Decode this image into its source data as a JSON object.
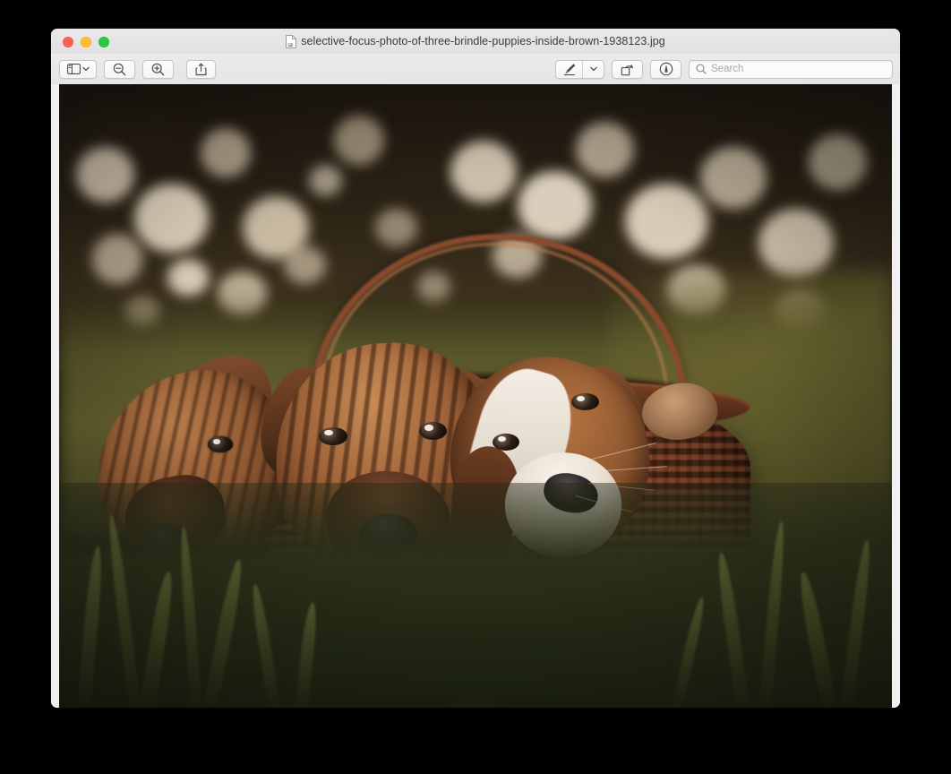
{
  "window": {
    "title": "selective-focus-photo-of-three-brindle-puppies-inside-brown-1938123.jpg",
    "traffic_lights": [
      {
        "name": "close",
        "color": "#ff5f57"
      },
      {
        "name": "minimize",
        "color": "#febc2e"
      },
      {
        "name": "zoom",
        "color": "#28c840"
      }
    ]
  },
  "toolbar": {
    "sidebar_button": "sidebar-toggle",
    "zoom_out_button": "zoom-out",
    "zoom_in_button": "zoom-in",
    "share_button": "share",
    "markup_button": "markup",
    "markup_options_button": "markup-options",
    "rotate_button": "rotate-left",
    "annotate_button": "annotate",
    "search": {
      "placeholder": "Search",
      "value": ""
    }
  },
  "image": {
    "subject": "three brindle puppies inside a brown wicker basket",
    "background": "golden bokeh foliage and green grass",
    "puppies": [
      {
        "position": "left",
        "coat": "brindle tan",
        "markings": "dark muzzle"
      },
      {
        "position": "center",
        "coat": "brindle tan",
        "markings": "dark muzzle"
      },
      {
        "position": "right",
        "coat": "brindle tan",
        "markings": "white blaze and muzzle"
      }
    ],
    "basket_color": "#7a4224",
    "grass_color": "#2b3019"
  }
}
